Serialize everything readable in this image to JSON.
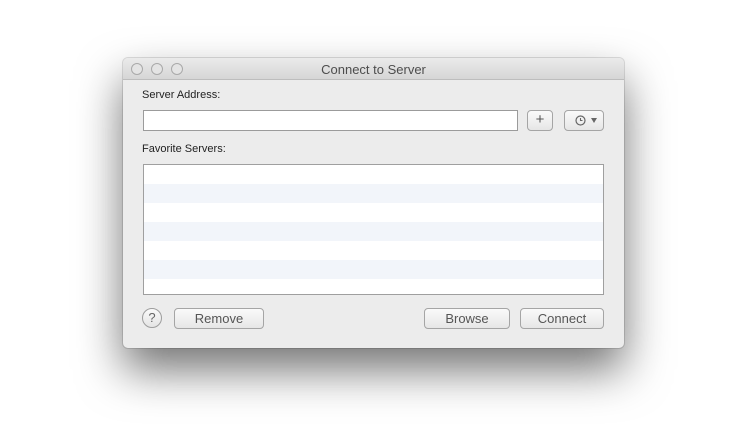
{
  "window": {
    "title": "Connect to Server"
  },
  "form": {
    "server_address_label": "Server Address:",
    "server_address_value": "",
    "add_label": "+",
    "favorite_servers_label": "Favorite Servers:",
    "favorite_servers": []
  },
  "buttons": {
    "help_label": "?",
    "remove_label": "Remove",
    "browse_label": "Browse",
    "connect_label": "Connect"
  },
  "icons": {
    "window_controls": [
      "close-icon",
      "minimize-icon",
      "zoom-icon"
    ],
    "recent_servers": "clock-icon",
    "recent_menu": "chevron-down-icon"
  }
}
